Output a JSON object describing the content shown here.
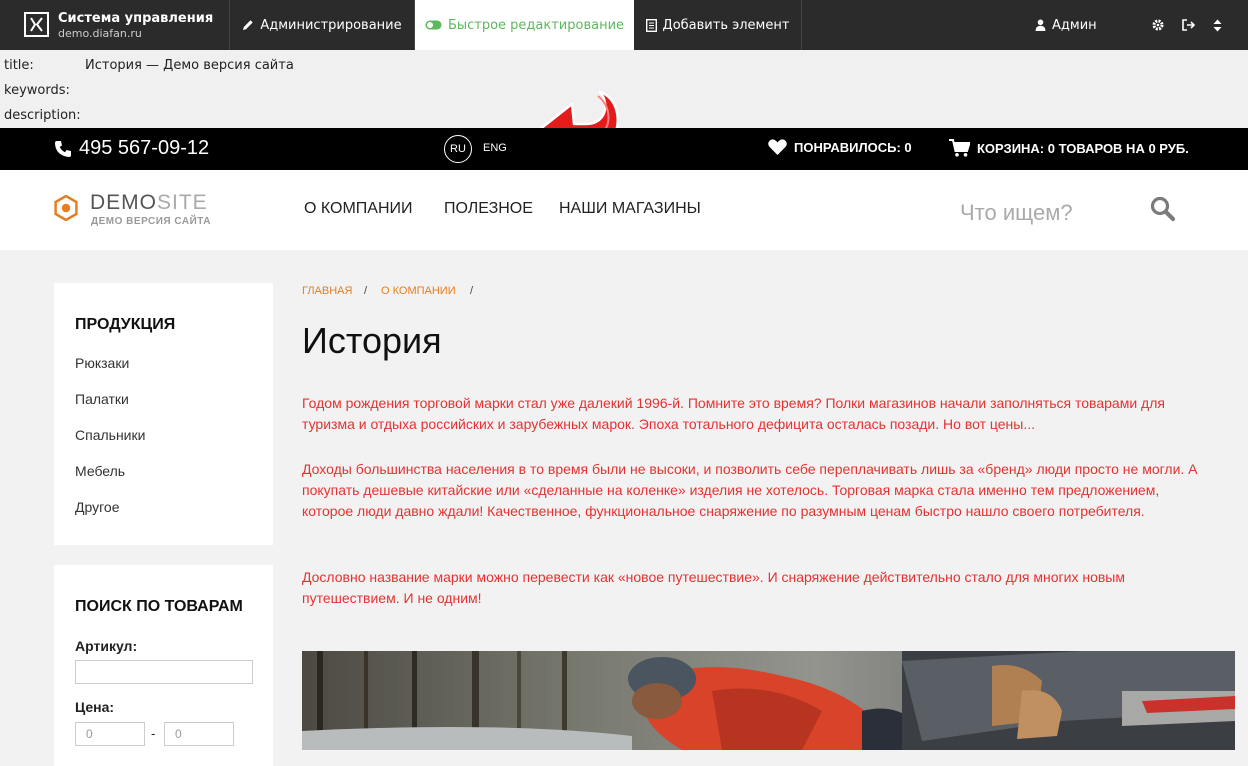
{
  "adminbar": {
    "title": "Система управления",
    "domain": "demo.diafan.ru",
    "admin_label": "Администрирование",
    "quick_edit_label": "Быстрое редактирование",
    "add_label": "Добавить элемент",
    "user_label": "Админ"
  },
  "meta": {
    "title_key": "title:",
    "title_value": "История — Демо версия сайта",
    "keywords_key": "keywords:",
    "description_key": "description:"
  },
  "sitebar": {
    "phone": "495 567-09-12",
    "lang_ru": "RU",
    "lang_en": "ENG",
    "likes": "ПОНРАВИЛОСЬ: 0",
    "cart": "КОРЗИНА: 0 ТОВАРОВ НА 0 РУБ."
  },
  "header": {
    "logo_demo": "DEMO",
    "logo_site": "SITE",
    "logo_sub": "ДЕМО ВЕРСИЯ САЙТА",
    "nav": [
      "О КОМПАНИИ",
      "ПОЛЕЗНОЕ",
      "НАШИ МАГАЗИНЫ"
    ],
    "search_placeholder": "Что ищем?"
  },
  "sidebar": {
    "products_title": "ПРОДУКЦИЯ",
    "categories": [
      "Рюкзаки",
      "Палатки",
      "Спальники",
      "Мебель",
      "Другое"
    ],
    "search_title": "ПОИСК ПО ТОВАРАМ",
    "article_label": "Артикул:",
    "price_label": "Цена:",
    "price_from": "0",
    "price_to": "0",
    "price_dash": "-"
  },
  "content": {
    "breadcrumb": [
      "ГЛАВНАЯ",
      "О КОМПАНИИ"
    ],
    "breadcrumb_sep": "/",
    "heading": "История",
    "paragraphs": [
      "Годом рождения торговой марки стал уже далекий 1996-й. Помните это время? Полки магазинов начали заполняться товарами для туризма и отдыха российских и зарубежных марок. Эпоха тотального дефицита осталась позади. Но вот цены...",
      "Доходы большинства населения в то время были не высоки, и позволить себе переплачивать лишь за «бренд» люди просто не могли. А покупать дешевые китайские или «сделанные на коленке» изделия не хотелось. Торговая марка стала именно тем предложением, которое люди давно ждали! Качественное, функциональное снаряжение по разумным ценам быстро нашло своего потребителя.",
      "Дословно название марки можно перевести как «новое путешествие». И снаряжение действительно стало для многих новым путешествием. И не одним!"
    ]
  },
  "colors": {
    "accent_orange": "#e77e22",
    "text_red": "#e53232",
    "toggle_green": "#5cb85c",
    "admin_bg": "#2b2b2b"
  }
}
